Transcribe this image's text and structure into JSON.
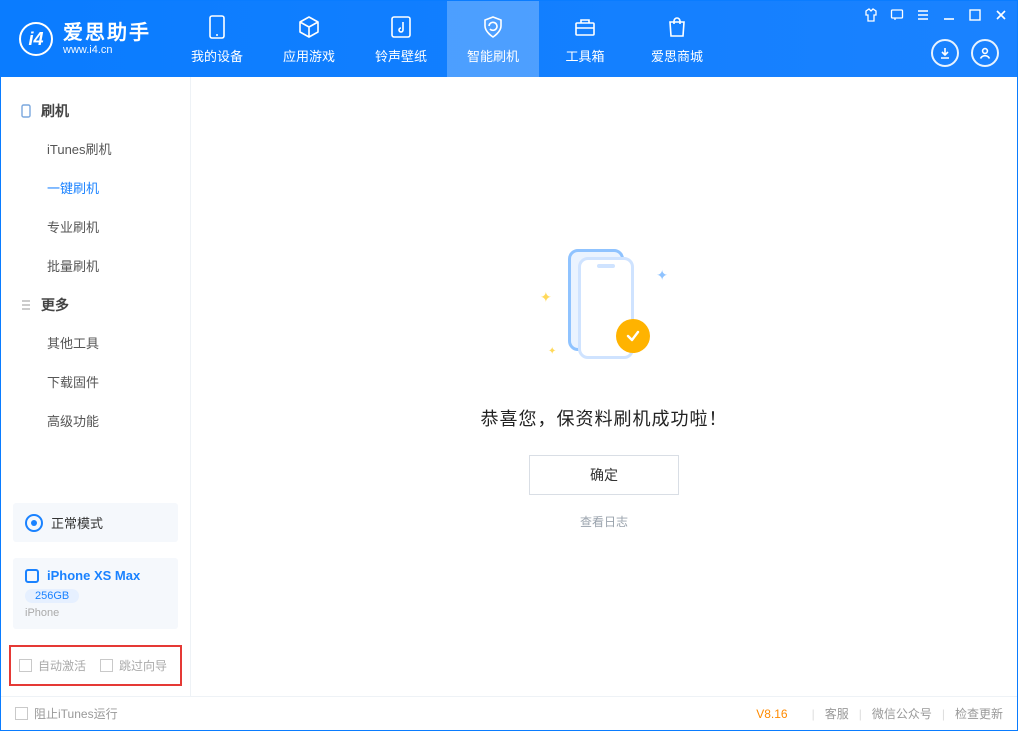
{
  "brand": {
    "cn": "爱思助手",
    "en": "www.i4.cn"
  },
  "topTabs": {
    "device": "我的设备",
    "apps": "应用游戏",
    "ring": "铃声壁纸",
    "flash": "智能刷机",
    "toolbox": "工具箱",
    "store": "爱思商城"
  },
  "sidebar": {
    "group1": "刷机",
    "items1": {
      "itunes": "iTunes刷机",
      "oneclick": "一键刷机",
      "pro": "专业刷机",
      "batch": "批量刷机"
    },
    "group2": "更多",
    "items2": {
      "other": "其他工具",
      "fw": "下载固件",
      "adv": "高级功能"
    }
  },
  "mode": {
    "label": "正常模式"
  },
  "device": {
    "name": "iPhone XS Max",
    "storage": "256GB",
    "type": "iPhone"
  },
  "options": {
    "autoActivate": "自动激活",
    "skipGuide": "跳过向导"
  },
  "main": {
    "message": "恭喜您，保资料刷机成功啦！",
    "ok": "确定",
    "viewLog": "查看日志"
  },
  "footer": {
    "blockItunes": "阻止iTunes运行",
    "version": "V8.16",
    "cs": "客服",
    "wechat": "微信公众号",
    "update": "检查更新"
  }
}
